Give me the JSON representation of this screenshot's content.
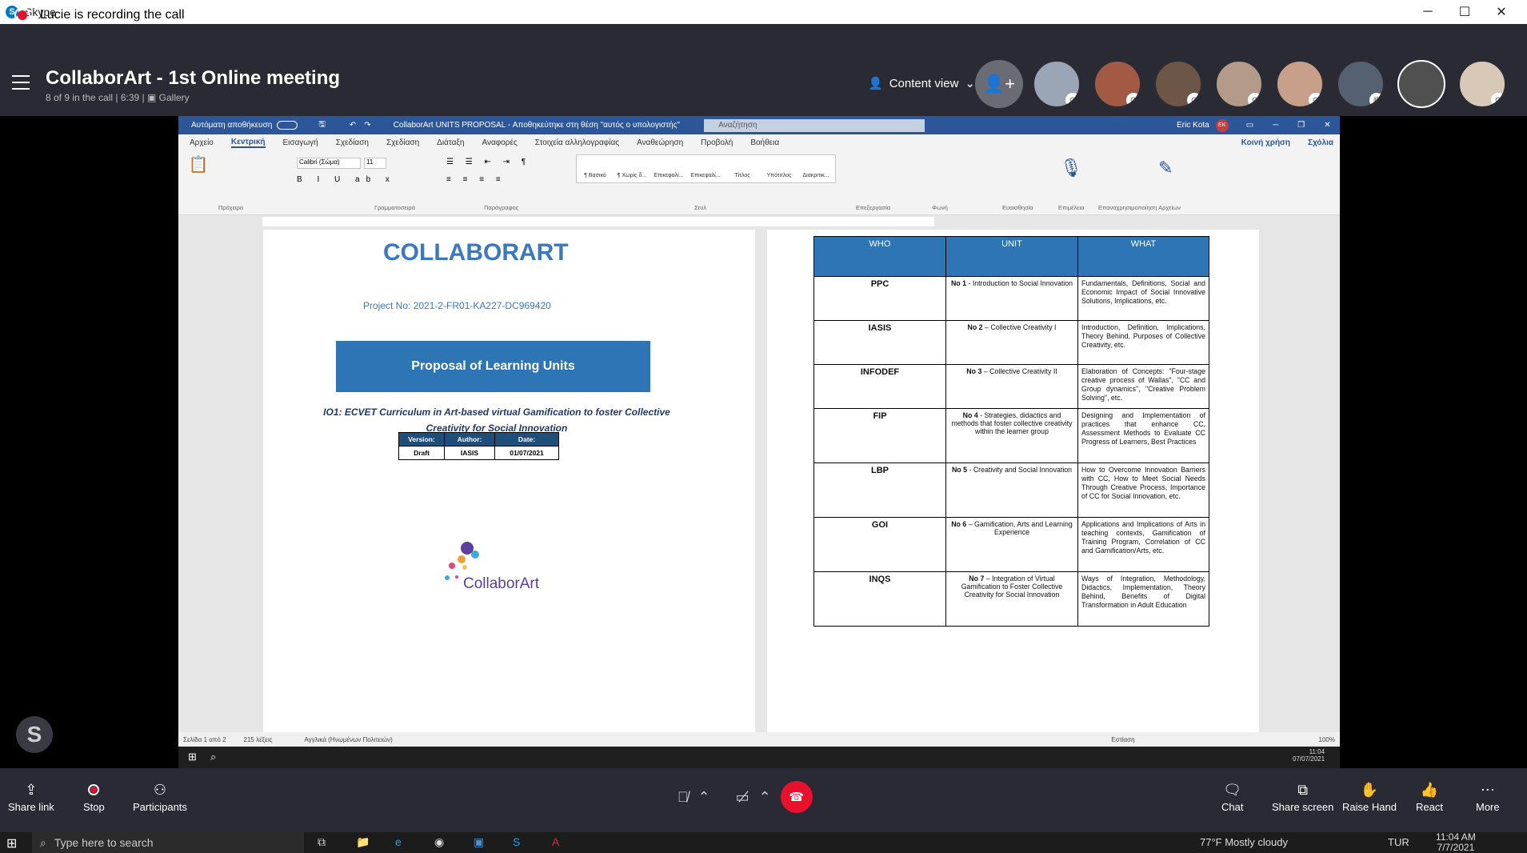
{
  "window": {
    "title": "Skype"
  },
  "recording": {
    "text": "Lucie is recording the call"
  },
  "meeting": {
    "title": "CollaborArt - 1st Online meeting",
    "subtitle": "8 of 9 in the call | 6:39 |",
    "layout": "Gallery",
    "content_view": "Content view"
  },
  "word": {
    "autosave": "Αυτόματη αποθήκευση",
    "doc_title": "CollaborArt UNITS PROPOSAL - Αποθηκεύτηκε στη θέση \"αυτός ο υπολογιστής\"",
    "search": "Αναζήτηση",
    "user": "Eric Kota",
    "tabs": [
      "Αρχείο",
      "Κεντρική",
      "Εισαγωγή",
      "Σχεδίαση",
      "Σχεδίαση",
      "Διάταξη",
      "Αναφορές",
      "Στοιχεία αλληλογραφίας",
      "Αναθεώρηση",
      "Προβολή",
      "Βοήθεια"
    ],
    "share": "Κοινή χρήση",
    "comments": "Σχόλια",
    "font": "Calibri (Σώμα)",
    "size": "11",
    "groups": [
      "Πρόχειρο",
      "Γραμματοσειρά",
      "Παράγραφος",
      "Στυλ",
      "Επεξεργασία",
      "Φωνή",
      "Ευαισθησία",
      "Επιμέλεια",
      "Επαναχρησιμοποίηση Αρχείων"
    ],
    "styles": [
      "¶ Βασικό",
      "¶ Χωρίς δ...",
      "Επικεφαλί...",
      "Επικεφαλί...",
      "Τίτλος",
      "Υπότιτλος",
      "Διακριτικ..."
    ],
    "status": {
      "page": "Σελίδα 1 από 2",
      "words": "215 λέξεις",
      "lang": "Αγγλικά (Ηνωμένων Πολιτειών)",
      "focus": "Εστίαση",
      "zoom": "100%"
    },
    "clock": {
      "time": "11:04",
      "date": "07/07/2021"
    }
  },
  "page1": {
    "logo": "COLLABORART",
    "project": "Project No: 2021-2-FR01-KA227-DC969420",
    "proposal": "Proposal of Learning Units",
    "io1": "IO1: ECVET Curriculum in Art-based virtual Gamification to foster Collective Creativity for Social Innovation",
    "version_table": {
      "headers": [
        "Version:",
        "Author:",
        "Date:"
      ],
      "row": [
        "Draft",
        "IASIS",
        "01/07/2021"
      ]
    },
    "brand": "CollaborArt"
  },
  "page2": {
    "headers": [
      "WHO",
      "UNIT",
      "WHAT"
    ],
    "rows": [
      {
        "who": "PPC",
        "unit_b": "No 1",
        "unit": " - Introduction to Social Innovation",
        "what": "Fundamentals, Definitions, Social and Economic Impact of Social Innovative Solutions, Implications, etc."
      },
      {
        "who": "IASIS",
        "unit_b": "No 2",
        "unit": " – Collective Creativity I",
        "what": "Introduction, Definition, Implications, Theory Behind, Purposes of Collective Creativity, etc."
      },
      {
        "who": "INFODEF",
        "unit_b": "No 3",
        "unit": " – Collective Creativity II",
        "what": "Elaboration of Concepts: \"Four-stage creative process of Wallas\", \"CC and Group dynamics\", \"Creative Problem Solving\", etc."
      },
      {
        "who": "FIP",
        "unit_b": "No 4",
        "unit": " - Strategies, didactics and methods that foster collective creativity within the learner group",
        "what": "Designing and Implementation of practices that enhance CC, Assessment Methods to Evaluate CC Progress of Learners, Best Practices"
      },
      {
        "who": "LBP",
        "unit_b": "No 5",
        "unit": " - Creativity and Social Innovation",
        "what": "How to Overcome Innovation Barriers with CC, How to Meet Social Needs Through Creative Process, Importance of CC for Social Innovation, etc."
      },
      {
        "who": "GOI",
        "unit_b": "No 6",
        "unit": " – Gamification, Arts and Learning Experience",
        "what": "Applications and Implications of Arts in teaching contexts, Gamification of Training Program, Correlation of CC and Gamification/Arts, etc."
      },
      {
        "who": "INQS",
        "unit_b": "No 7",
        "unit": " – Integration of Virtual Gamification to Foster Collective Creativity for Social Innovation",
        "what": "Ways of Integration, Methodology, Didactics, Implementation, Theory Behind, Benefits of Digital Transformation in Adult Education"
      }
    ]
  },
  "controls": {
    "share_link": "Share link",
    "stop": "Stop",
    "participants": "Participants",
    "chat": "Chat",
    "share_screen": "Share screen",
    "raise_hand": "Raise Hand",
    "react": "React",
    "more": "More"
  },
  "taskbar": {
    "search": "Type here to search",
    "weather": "77°F Mostly cloudy",
    "lang": "TUR",
    "time": "11:04 AM",
    "date": "7/7/2021"
  }
}
